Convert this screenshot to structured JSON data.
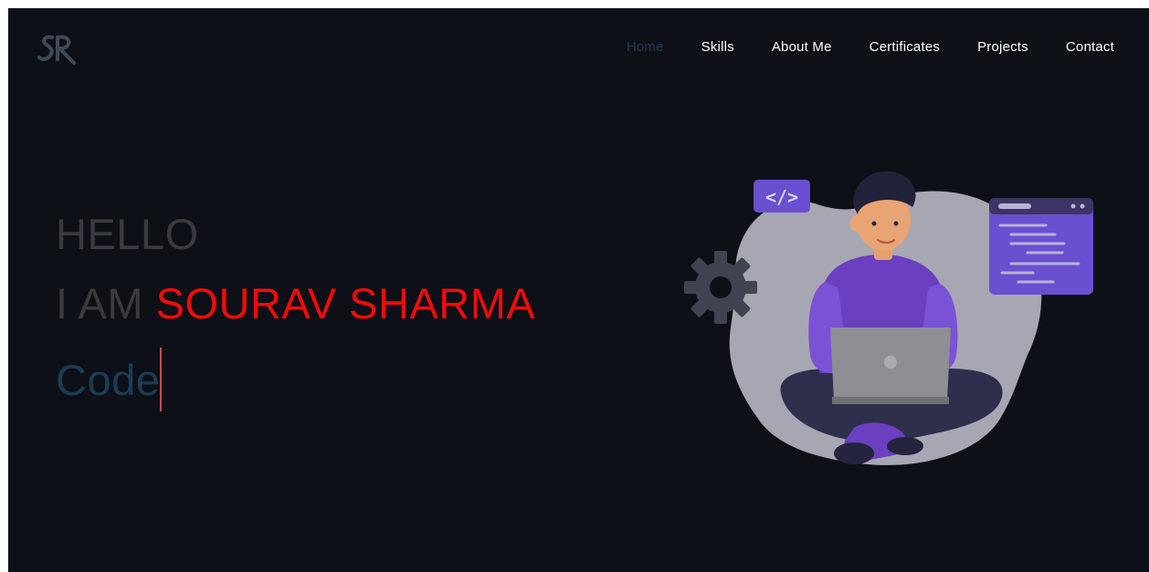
{
  "nav": {
    "logo_text": "SR",
    "items": [
      {
        "label": "Home",
        "active": true
      },
      {
        "label": "Skills",
        "active": false
      },
      {
        "label": "About Me",
        "active": false
      },
      {
        "label": "Certificates",
        "active": false
      },
      {
        "label": "Projects",
        "active": false
      },
      {
        "label": "Contact",
        "active": false
      }
    ]
  },
  "hero": {
    "greeting": "HELLO",
    "intro_prefix": "I AM ",
    "name": "SOURAV SHARMA",
    "typed_text": "Code"
  },
  "colors": {
    "background": "#0d1016",
    "accent_name": "#f20b0b",
    "typed_text": "#1c3c55",
    "active_nav": "#213b52",
    "illustration_purple": "#6a3fc0",
    "illustration_blob": "#a7a7b3"
  },
  "icons": {
    "code_badge": "code-brackets-icon",
    "gear": "gear-icon",
    "window": "browser-window-icon"
  }
}
